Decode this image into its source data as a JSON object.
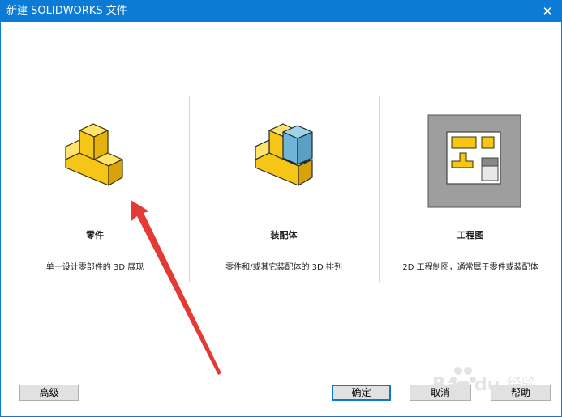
{
  "window": {
    "title": "新建 SOLIDWORKS 文件",
    "close_glyph": "✕"
  },
  "templates": [
    {
      "label": "零件",
      "description": "单一设计零部件的 3D 展现",
      "icon": "part-icon"
    },
    {
      "label": "装配体",
      "description": "零件和/或其它装配体的 3D 排列",
      "icon": "assembly-icon"
    },
    {
      "label": "工程图",
      "description": "2D 工程制图，通常属于零件或装配体",
      "icon": "drawing-icon"
    }
  ],
  "buttons": {
    "advanced": "高级",
    "ok": "确定",
    "cancel": "取消",
    "help": "帮助"
  },
  "colors": {
    "titlebar": "#0b7bd6",
    "part_yellow": "#f5c518",
    "assembly_blue": "#6fb5d8",
    "annotation_arrow": "#e53935"
  }
}
